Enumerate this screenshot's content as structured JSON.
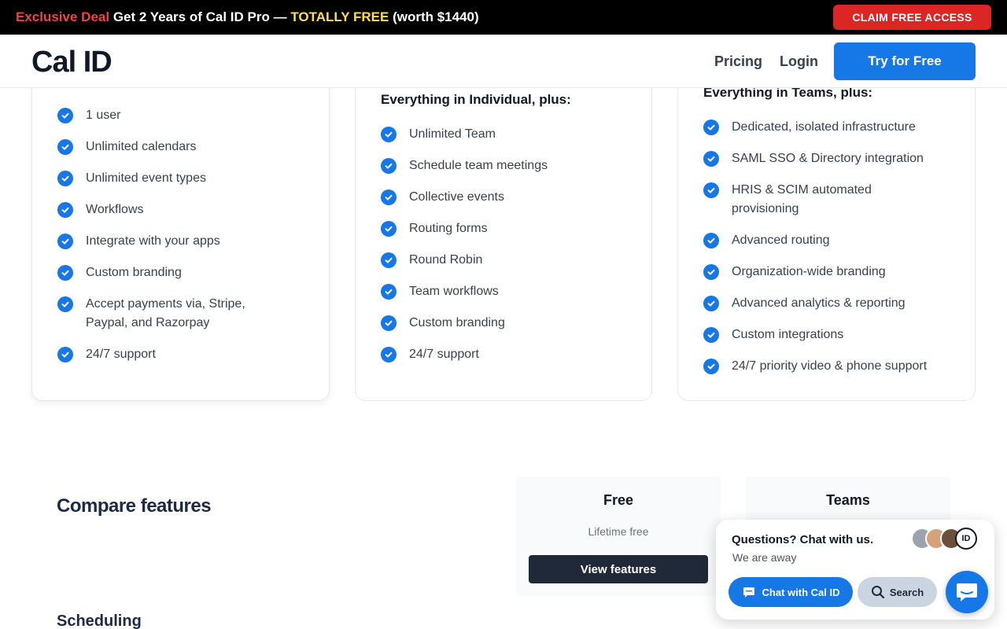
{
  "promo": {
    "deal_label": "Exclusive Deal",
    "text_main": "Get 2 Years of Cal ID Pro —",
    "free_label": "TOTALLY FREE",
    "worth": "(worth $1440)",
    "claim_button": "CLAIM FREE ACCESS"
  },
  "header": {
    "logo": "Cal ID",
    "nav": {
      "pricing": "Pricing",
      "login": "Login"
    },
    "cta": "Try for Free"
  },
  "cards": {
    "individual": {
      "features": [
        "1 user",
        "Unlimited calendars",
        "Unlimited event types",
        "Workflows",
        "Integrate with your apps",
        "Custom branding",
        "Accept payments via, Stripe, Paypal, and Razorpay",
        "24/7 support"
      ]
    },
    "teams": {
      "heading": "Everything in Individual, plus:",
      "features": [
        "Unlimited Team",
        "Schedule team meetings",
        "Collective events",
        "Routing forms",
        "Round Robin",
        "Team workflows",
        "Custom branding",
        "24/7 support"
      ]
    },
    "enterprise": {
      "heading": "Everything in Teams, plus:",
      "features": [
        "Dedicated, isolated infrastructure",
        "SAML SSO & Directory integration",
        "HRIS & SCIM automated provisioning",
        "Advanced routing",
        "Organization-wide branding",
        "Advanced analytics & reporting",
        "Custom integrations",
        "24/7 priority video & phone support"
      ]
    }
  },
  "compare": {
    "title": "Compare features",
    "section_scheduling": "Scheduling",
    "plans": [
      {
        "name": "Free",
        "sub": "Lifetime free",
        "button": "View features"
      },
      {
        "name": "Teams"
      }
    ]
  },
  "chat": {
    "title": "Questions? Chat with us.",
    "status": "We are away",
    "chat_button": "Chat with Cal ID",
    "search_button": "Search",
    "avatar_badge": "ID"
  },
  "colors": {
    "brand_blue": "#1677e6",
    "promo_red": "#dc2626",
    "promo_yellow": "#fde047",
    "dark": "#1f2937"
  }
}
